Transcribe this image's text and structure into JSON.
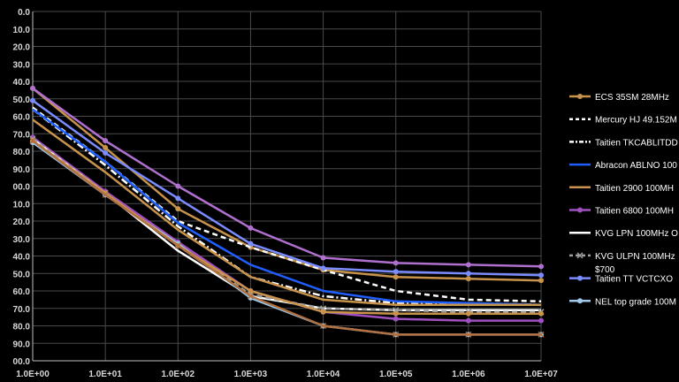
{
  "chart_data": {
    "type": "line",
    "x_scale": "log",
    "x": [
      1,
      10,
      100,
      1000,
      10000,
      100000,
      1000000,
      10000000
    ],
    "x_tick_labels": [
      "1.0E+00",
      "1.0E+01",
      "1.0E+02",
      "1.0E+03",
      "1.0E+04",
      "1.0E+05",
      "1.0E+06",
      "1.0E+07"
    ],
    "y_tick_labels": [
      "0.0",
      "10.0",
      "20.0",
      "30.0",
      "40.0",
      "50.0",
      "60.0",
      "70.0",
      "80.0",
      "90.0",
      "00.0",
      "10.0",
      "20.0",
      "30.0",
      "40.0",
      "50.0",
      "60.0",
      "70.0",
      "80.0",
      "90.0",
      "00.0"
    ],
    "ylim": [
      0,
      200
    ],
    "y_direction": "down",
    "grid": true,
    "legend_position": "right",
    "series": [
      {
        "name": "ECS  35SM 28MHz",
        "color": "#c8934a",
        "dash": "solid",
        "marker": "circle",
        "values": [
          44,
          78,
          113,
          135,
          148,
          152,
          153,
          154
        ]
      },
      {
        "name": "Mercury HJ 49.152M",
        "color": "#ffffff",
        "dash": "dash",
        "marker": "none",
        "values": [
          55,
          86,
          120,
          135,
          148,
          160,
          165,
          166
        ]
      },
      {
        "name": "Taitien TKCABLITDD",
        "color": "#ffffff",
        "dash": "dashdot",
        "marker": "none",
        "values": [
          56,
          88,
          123,
          152,
          163,
          167,
          167,
          168
        ]
      },
      {
        "name": "Abracon ABLNO 100",
        "color": "#1f5fff",
        "dash": "solid",
        "marker": "none",
        "values": [
          56,
          86,
          121,
          145,
          160,
          166,
          167,
          168
        ]
      },
      {
        "name": "Taitien 2900 100MH",
        "color": "#c8934a",
        "dash": "solid",
        "marker": "none",
        "values": [
          62,
          92,
          125,
          152,
          165,
          168,
          168,
          168
        ]
      },
      {
        "name": "Taitien 6800 100MH",
        "color": "#a050c0",
        "dash": "solid",
        "marker": "circle",
        "values": [
          72,
          103,
          132,
          160,
          172,
          176,
          177,
          177
        ]
      },
      {
        "name": "KVG LPN 100MHz O",
        "color": "#ffffff",
        "dash": "solid",
        "marker": "none",
        "values": [
          73,
          104,
          137,
          163,
          170,
          171,
          171,
          171
        ]
      },
      {
        "name": "KVG ULPN 100MHz",
        "color": "#a0a0a0",
        "dash": "dash",
        "marker": "x",
        "values": [
          73,
          104,
          134,
          162,
          170,
          171,
          172,
          172
        ]
      },
      {
        "name": "$700",
        "color": "#ffffff",
        "dash": "none",
        "marker": "none",
        "values": []
      },
      {
        "name": "Taitien TT VCTCXO",
        "color": "#7a8cff",
        "dash": "solid",
        "marker": "circle",
        "values": [
          51,
          81,
          107,
          133,
          147,
          149,
          150,
          151
        ]
      },
      {
        "name": "NEL top grade 100M",
        "color": "#9ec8e8",
        "dash": "solid",
        "marker": "circle",
        "values": [
          75,
          105,
          133,
          164,
          180,
          185,
          185,
          185
        ]
      },
      {
        "name": "",
        "color": "#b070d0",
        "dash": "solid",
        "marker": "circle",
        "values": [
          44,
          74,
          100,
          124,
          141,
          144,
          145,
          146
        ]
      },
      {
        "name": "",
        "color": "#c8934a",
        "dash": "solid",
        "marker": "circle",
        "values": [
          74,
          104,
          134,
          160,
          172,
          173,
          173,
          173
        ]
      },
      {
        "name": "",
        "color": "#b07040",
        "dash": "solid",
        "marker": "x",
        "values": [
          74,
          105,
          134,
          163,
          180,
          185,
          185,
          185
        ]
      }
    ]
  }
}
